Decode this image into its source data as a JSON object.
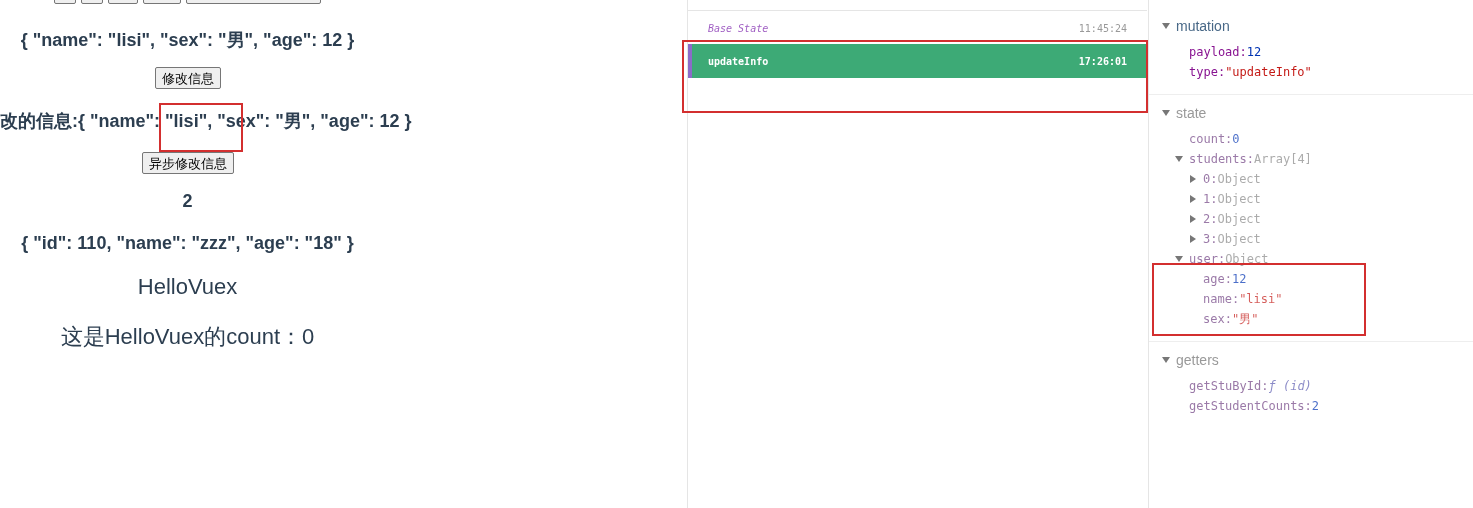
{
  "app": {
    "lines": [
      {
        "kind": "heading",
        "text": "{ \"name\": \"lisi\", \"sex\": \"男\", \"age\": 12 }"
      },
      {
        "kind": "button",
        "text": "修改信息"
      },
      {
        "kind": "cut_heading",
        "text": "改的信息:{ \"name\": \"lisi\", \"sex\": \"男\", \"age\": 12 }"
      },
      {
        "kind": "button",
        "text": "异步修改信息"
      },
      {
        "kind": "heading",
        "text": "2"
      },
      {
        "kind": "heading",
        "text": "{ \"id\": 110, \"name\": \"zzz\", \"age\": \"18\" }"
      },
      {
        "kind": "large",
        "text": "HelloVuex"
      },
      {
        "kind": "large",
        "text": "这是HelloVuex的count：0"
      }
    ]
  },
  "timeline": [
    {
      "kind": "base",
      "label": "Base State",
      "time": "11:45:24",
      "selected": false
    },
    {
      "kind": "mutation",
      "label": "updateInfo",
      "time": "17:26:01",
      "selected": true
    }
  ],
  "inspector": [
    {
      "title": "mutation",
      "expanded": true,
      "active": true,
      "entries": [
        {
          "key": "payload:",
          "value": "12",
          "kind": "number"
        },
        {
          "key": "type:",
          "value": "\"updateInfo\"",
          "kind": "string"
        }
      ]
    },
    {
      "title": "state",
      "expanded": true,
      "active": false,
      "entries": [
        {
          "key": "count:",
          "value": "0",
          "kind": "number"
        },
        {
          "key": "students:",
          "value": "Array[4]",
          "kind": "object",
          "expanded": true,
          "children": [
            {
              "key": "0:",
              "value": "Object",
              "kind": "object",
              "expanded": false
            },
            {
              "key": "1:",
              "value": "Object",
              "kind": "object",
              "expanded": false
            },
            {
              "key": "2:",
              "value": "Object",
              "kind": "object",
              "expanded": false
            },
            {
              "key": "3:",
              "value": "Object",
              "kind": "object",
              "expanded": false
            }
          ]
        },
        {
          "key": "user:",
          "value": "Object",
          "kind": "object",
          "expanded": true,
          "children": [
            {
              "key": "age:",
              "value": "12",
              "kind": "number"
            },
            {
              "key": "name:",
              "value": "\"lisi\"",
              "kind": "string"
            },
            {
              "key": "sex:",
              "value": "\"男\"",
              "kind": "string"
            }
          ]
        }
      ]
    },
    {
      "title": "getters",
      "expanded": true,
      "active": false,
      "entries": [
        {
          "key": "getStuById:",
          "value": "ƒ (id)",
          "kind": "function"
        },
        {
          "key": "getStudentCounts:",
          "value": "2",
          "kind": "number"
        }
      ]
    }
  ]
}
